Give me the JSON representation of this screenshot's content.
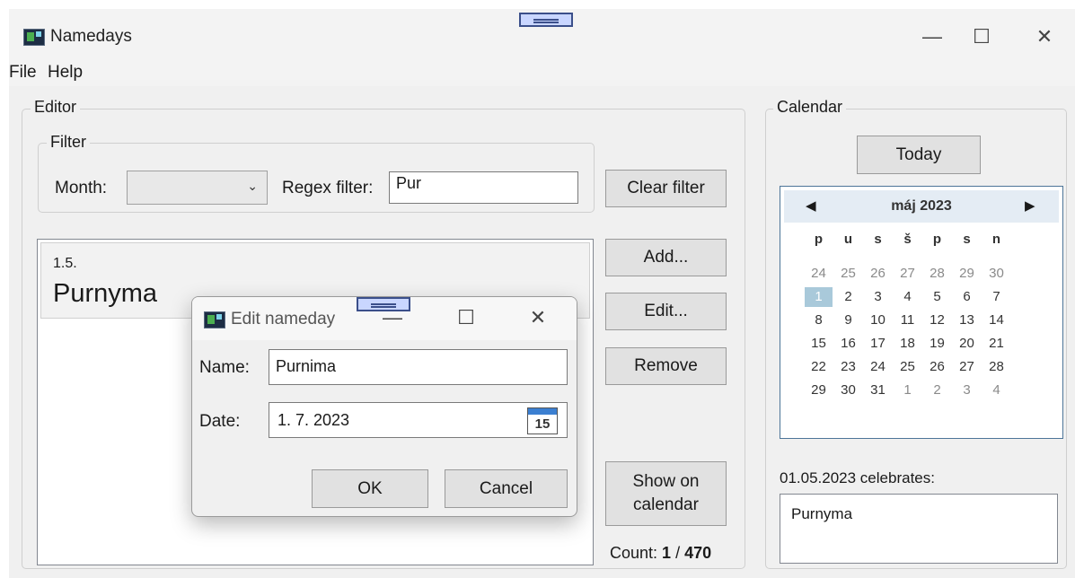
{
  "window": {
    "title": "Namedays",
    "minimize_glyph": "—",
    "maximize_glyph": "☐",
    "close_glyph": "✕"
  },
  "menu": [
    "File",
    "Help"
  ],
  "editor": {
    "legend": "Editor",
    "filter": {
      "legend": "Filter",
      "month_label": "Month:",
      "month_value": "",
      "regex_label": "Regex filter:",
      "regex_value": "Pur"
    },
    "clear_filter": "Clear filter",
    "list": [
      {
        "date": "1.5.",
        "name": "Purnyma"
      }
    ],
    "add": "Add...",
    "edit": "Edit...",
    "remove": "Remove",
    "show_on_calendar_1": "Show on",
    "show_on_calendar_2": "calendar",
    "count_label": "Count: ",
    "count_shown": "1",
    "count_sep": " / ",
    "count_total": "470"
  },
  "calendar": {
    "legend": "Calendar",
    "today": "Today",
    "month_title": "máj 2023",
    "prev_glyph": "◀",
    "next_glyph": "▶",
    "dow": [
      "p",
      "u",
      "s",
      "š",
      "p",
      "s",
      "n"
    ],
    "weeks": [
      [
        "24",
        "25",
        "26",
        "27",
        "28",
        "29",
        "30"
      ],
      [
        "1",
        "2",
        "3",
        "4",
        "5",
        "6",
        "7"
      ],
      [
        "8",
        "9",
        "10",
        "11",
        "12",
        "13",
        "14"
      ],
      [
        "15",
        "16",
        "17",
        "18",
        "19",
        "20",
        "21"
      ],
      [
        "22",
        "23",
        "24",
        "25",
        "26",
        "27",
        "28"
      ],
      [
        "29",
        "30",
        "31",
        "1",
        "2",
        "3",
        "4"
      ]
    ],
    "selected_date": "1",
    "selected_color": "#a9c9da",
    "celebrates_label": "01.05.2023 celebrates:",
    "celebrates": [
      "Purnyma"
    ]
  },
  "dialog": {
    "title": "Edit nameday",
    "name_label": "Name:",
    "name_value": "Purnima",
    "date_label": "Date:",
    "date_value": "1. 7. 2023",
    "calendar_icon_text": "15",
    "ok": "OK",
    "cancel": "Cancel"
  }
}
